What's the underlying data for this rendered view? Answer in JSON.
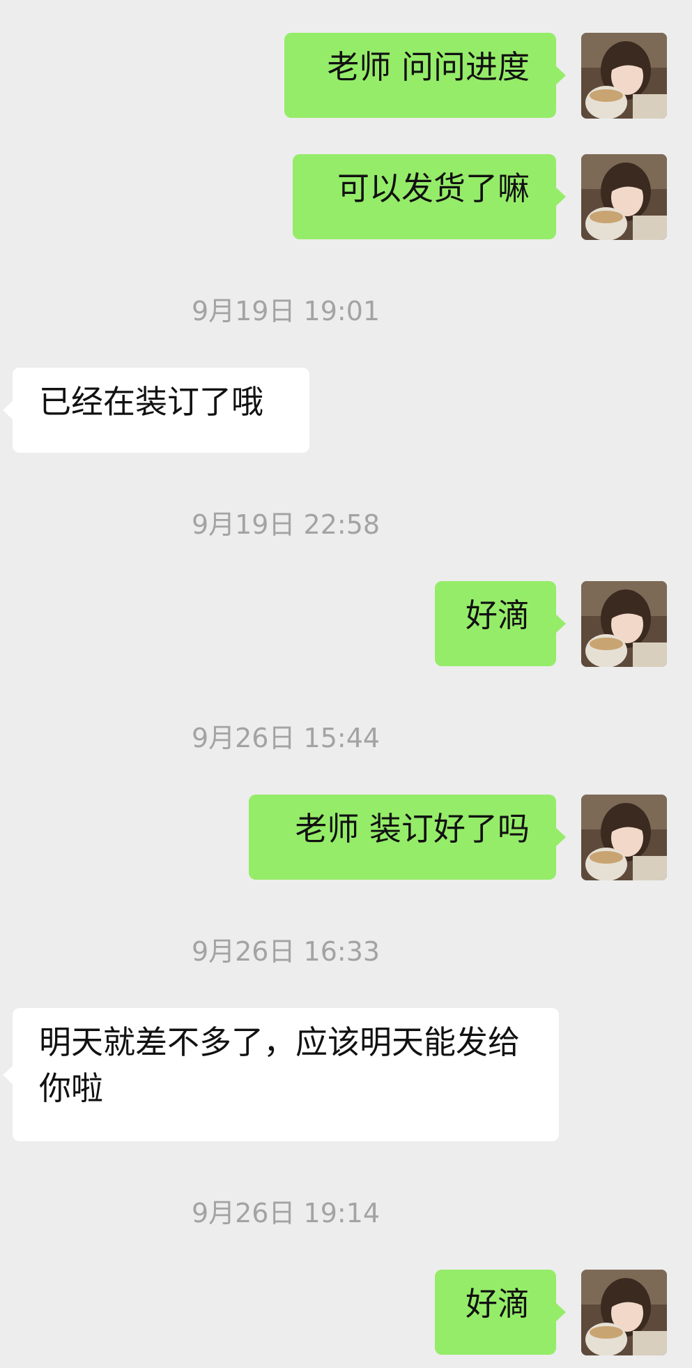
{
  "messages": [
    {
      "sender": "me",
      "text": "老师 问问进度"
    },
    {
      "sender": "me",
      "text": "可以发货了嘛"
    },
    {
      "type": "timestamp",
      "text": "9月19日 19:01"
    },
    {
      "sender": "other",
      "text": "已经在装订了哦"
    },
    {
      "type": "timestamp",
      "text": "9月19日 22:58"
    },
    {
      "sender": "me",
      "text": "好滴"
    },
    {
      "type": "timestamp",
      "text": "9月26日 15:44"
    },
    {
      "sender": "me",
      "text": "老师 装订好了吗"
    },
    {
      "type": "timestamp",
      "text": "9月26日 16:33"
    },
    {
      "sender": "other",
      "text": "明天就差不多了，应该明天能发给你啦"
    },
    {
      "type": "timestamp",
      "text": "9月26日 19:14"
    },
    {
      "sender": "me",
      "text": "好滴"
    }
  ],
  "colors": {
    "background": "#ededed",
    "my_bubble": "#95ec69",
    "their_bubble": "#ffffff",
    "timestamp_text": "#a3a3a3"
  }
}
